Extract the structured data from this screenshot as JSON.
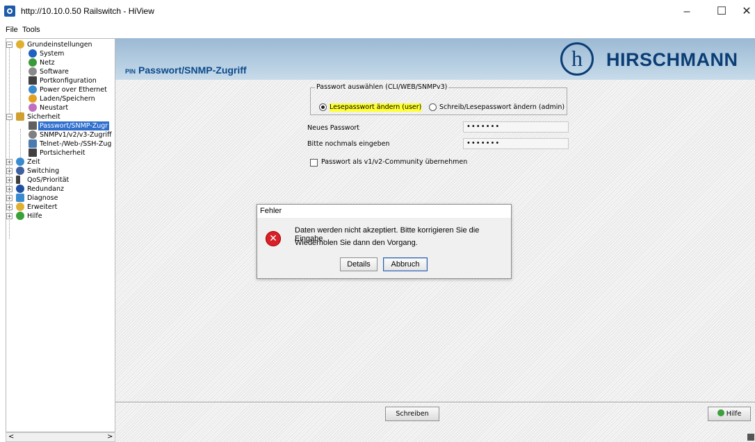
{
  "window": {
    "title": "http://10.10.0.50 Railswitch - HiView",
    "minimize": "–",
    "maximize": "☐",
    "close": "✕"
  },
  "menu": {
    "file": "File",
    "tools": "Tools"
  },
  "tree": {
    "items": [
      {
        "label": "Grundeinstellungen",
        "icon": "folder-star-icon",
        "color": "#e0b030"
      },
      {
        "label": "System",
        "icon": "info-icon",
        "color": "#2060c0"
      },
      {
        "label": "Netz",
        "icon": "network-icon",
        "color": "#3a9a3a"
      },
      {
        "label": "Software",
        "icon": "software-icon",
        "color": "#8a8a8a"
      },
      {
        "label": "Portkonfiguration",
        "icon": "port-icon",
        "color": "#404040"
      },
      {
        "label": "Power over Ethernet",
        "icon": "power-icon",
        "color": "#3a8ad0"
      },
      {
        "label": "Laden/Speichern",
        "icon": "save-icon",
        "color": "#e0a020"
      },
      {
        "label": "Neustart",
        "icon": "restart-icon",
        "color": "#c070c0"
      },
      {
        "label": "Sicherheit",
        "icon": "lock-icon",
        "color": "#d0a030"
      },
      {
        "label": "Passwort/SNMP-Zugr",
        "icon": "pin-icon",
        "color": "#606060"
      },
      {
        "label": "SNMPv1/v2/v3-Zugriff",
        "icon": "snmp-icon",
        "color": "#808080"
      },
      {
        "label": "Telnet-/Web-/SSH-Zug",
        "icon": "telnet-icon",
        "color": "#4a7ab0"
      },
      {
        "label": "Portsicherheit",
        "icon": "port-security-icon",
        "color": "#404040"
      },
      {
        "label": "Zeit",
        "icon": "clock-icon",
        "color": "#3a8ad0"
      },
      {
        "label": "Switching",
        "icon": "switching-icon",
        "color": "#4060a0"
      },
      {
        "label": "QoS/Priorität",
        "icon": "qos-icon",
        "color": "#404040"
      },
      {
        "label": "Redundanz",
        "icon": "redundancy-icon",
        "color": "#2050a0"
      },
      {
        "label": "Diagnose",
        "icon": "diagnosis-icon",
        "color": "#3a8ad0"
      },
      {
        "label": "Erweitert",
        "icon": "star-icon",
        "color": "#e0b030"
      },
      {
        "label": "Hilfe",
        "icon": "help-icon",
        "color": "#3aa03a"
      }
    ],
    "scroll_left": "<",
    "scroll_right": ">"
  },
  "banner": {
    "pin": "PIN",
    "title": "Passwort/SNMP-Zugriff",
    "logo_mark": "h",
    "logo_text": "HIRSCHMANN"
  },
  "form": {
    "group_legend": "Passwort auswählen (CLI/WEB/SNMPv3)",
    "radio_read": "Lesepasswort ändern (user)",
    "radio_write": "Schreib/Lesepasswort ändern (admin)",
    "new_password_label": "Neues Passwort",
    "new_password_value": "•••••••",
    "repeat_label": "Bitte nochmals eingeben",
    "repeat_value": "•••••••",
    "community_checkbox": "Passwort als v1/v2-Community übernehmen"
  },
  "bottom": {
    "write": "Schreiben",
    "help": "Hilfe"
  },
  "dialog": {
    "title": "Fehler",
    "line1": "Daten werden nicht akzeptiert. Bitte korrigieren Sie die Eingabe.",
    "line2": "Wiederholen Sie dann den Vorgang.",
    "details": "Details",
    "cancel": "Abbruch",
    "icon_glyph": "✕"
  },
  "colors": {
    "accent": "#0a3d75",
    "highlight": "#ffff33",
    "error": "#d8202a"
  }
}
